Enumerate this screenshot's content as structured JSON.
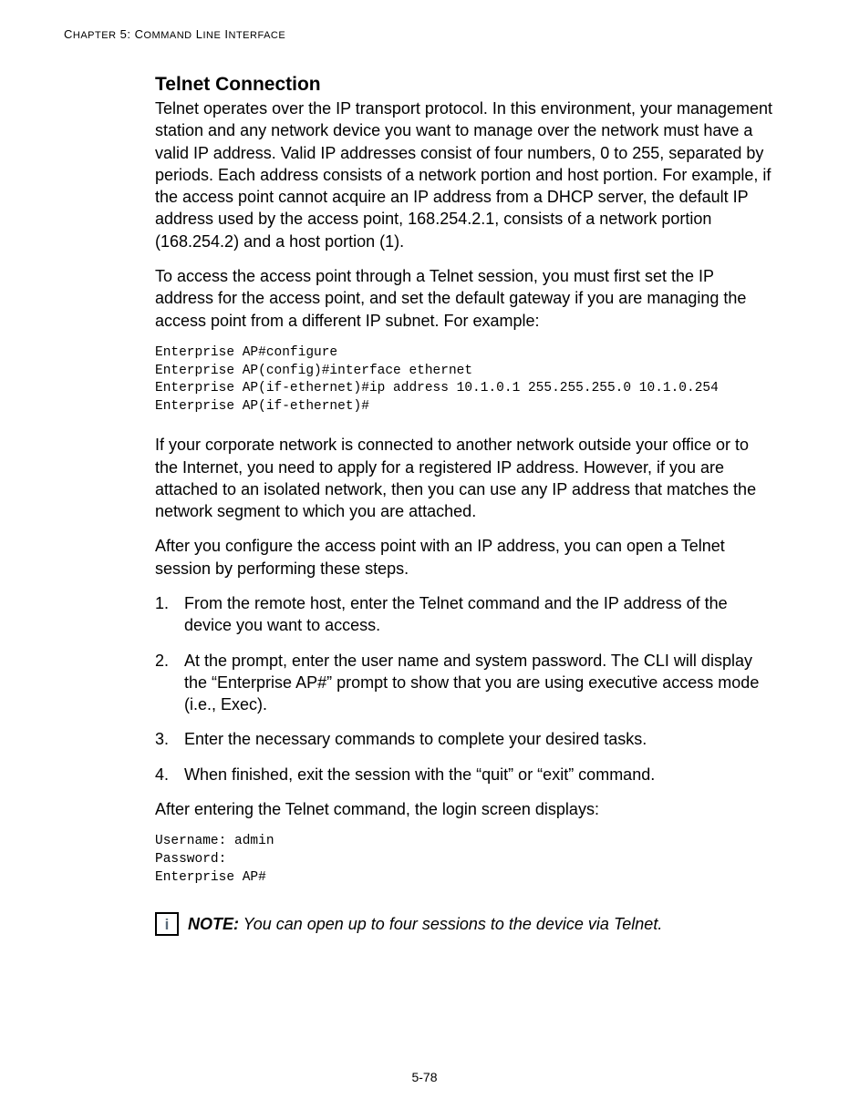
{
  "header": {
    "chapter_label": "Chapter 5: Command Line Interface"
  },
  "section": {
    "title": "Telnet Connection",
    "para1": "Telnet operates over the IP transport protocol. In this environment, your management station and any network device you want to manage over the network must have a valid IP address. Valid IP addresses consist of four numbers, 0 to 255, separated by periods. Each address consists of a network portion and host portion. For example, if the access point cannot acquire an IP address from a DHCP server, the default IP address used by the access point, 168.254.2.1, consists of a network portion (168.254.2) and a host portion (1).",
    "para2": "To access the access point through a Telnet session, you must first set the IP address for the access point, and set the default gateway if you are managing the access point from a different IP subnet. For example:",
    "code1": "Enterprise AP#configure\nEnterprise AP(config)#interface ethernet\nEnterprise AP(if-ethernet)#ip address 10.1.0.1 255.255.255.0 10.1.0.254\nEnterprise AP(if-ethernet)#",
    "para3": "If your corporate network is connected to another network outside your office or to the Internet, you need to apply for a registered IP address. However, if you are attached to an isolated network, then you can use any IP address that matches the network segment to which you are attached.",
    "para4": "After you configure the access point with an IP address, you can open a Telnet session by performing these steps.",
    "list": [
      {
        "num": "1.",
        "text": "From the remote host, enter the Telnet command and the IP address of the device you want to access."
      },
      {
        "num": "2.",
        "text": "At the prompt, enter the user name and system password. The CLI will display the “Enterprise AP#” prompt to show that you are using executive access mode (i.e., Exec)."
      },
      {
        "num": "3.",
        "text": "Enter the necessary commands to complete your desired tasks."
      },
      {
        "num": "4.",
        "text": "When finished, exit the session with the “quit” or “exit” command."
      }
    ],
    "para5": "After entering the Telnet command, the login screen displays:",
    "code2": "Username: admin\nPassword:\nEnterprise AP#",
    "note_label": "NOTE:",
    "note_text": " You can open up to four sessions to the device via Telnet.",
    "note_icon_letter": "i"
  },
  "footer": {
    "page": "5-78"
  }
}
